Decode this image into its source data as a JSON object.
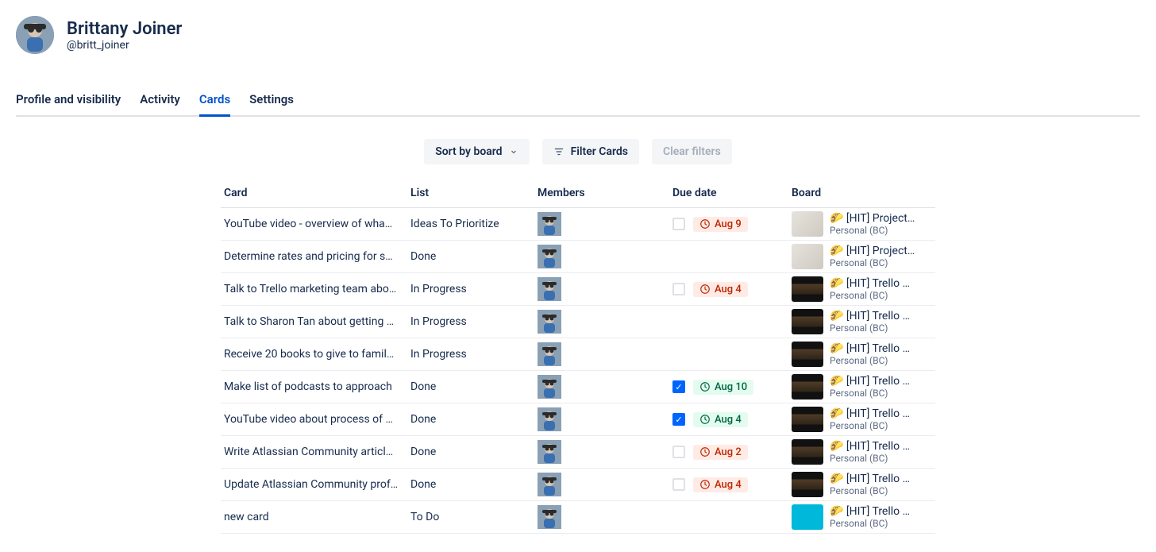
{
  "user": {
    "display_name": "Brittany Joiner",
    "handle": "@britt_joiner"
  },
  "tabs": [
    {
      "label": "Profile and visibility",
      "active": false
    },
    {
      "label": "Activity",
      "active": false
    },
    {
      "label": "Cards",
      "active": true
    },
    {
      "label": "Settings",
      "active": false
    }
  ],
  "controls": {
    "sort_label": "Sort by board",
    "filter_label": "Filter Cards",
    "clear_label": "Clear filters"
  },
  "columns": {
    "card": "Card",
    "list": "List",
    "members": "Members",
    "due": "Due date",
    "board": "Board"
  },
  "rows": [
    {
      "card": "YouTube video - overview of wha…",
      "list": "Ideas To Prioritize",
      "due": {
        "text": "Aug 9",
        "state": "overdue",
        "checked": false
      },
      "board": {
        "emoji": "🌮",
        "name": "[HIT] Project…",
        "sub": "Personal (BC)",
        "thumb": "light"
      }
    },
    {
      "card": "Determine rates and pricing for s…",
      "list": "Done",
      "due": null,
      "board": {
        "emoji": "🌮",
        "name": "[HIT] Project…",
        "sub": "Personal (BC)",
        "thumb": "light"
      }
    },
    {
      "card": "Talk to Trello marketing team abo…",
      "list": "In Progress",
      "due": {
        "text": "Aug 4",
        "state": "overdue",
        "checked": false
      },
      "board": {
        "emoji": "🌮",
        "name": "[HIT] Trello …",
        "sub": "Personal (BC)",
        "thumb": "dark"
      }
    },
    {
      "card": "Talk to Sharon Tan about getting …",
      "list": "In Progress",
      "due": null,
      "board": {
        "emoji": "🌮",
        "name": "[HIT] Trello …",
        "sub": "Personal (BC)",
        "thumb": "dark"
      }
    },
    {
      "card": "Receive 20 books to give to famil…",
      "list": "In Progress",
      "due": null,
      "board": {
        "emoji": "🌮",
        "name": "[HIT] Trello …",
        "sub": "Personal (BC)",
        "thumb": "dark"
      }
    },
    {
      "card": "Make list of podcasts to approach",
      "list": "Done",
      "due": {
        "text": "Aug 10",
        "state": "done",
        "checked": true
      },
      "board": {
        "emoji": "🌮",
        "name": "[HIT] Trello …",
        "sub": "Personal (BC)",
        "thumb": "dark"
      }
    },
    {
      "card": "YouTube video about process of …",
      "list": "Done",
      "due": {
        "text": "Aug 4",
        "state": "done",
        "checked": true
      },
      "board": {
        "emoji": "🌮",
        "name": "[HIT] Trello …",
        "sub": "Personal (BC)",
        "thumb": "dark"
      }
    },
    {
      "card": "Write Atlassian Community articl…",
      "list": "Done",
      "due": {
        "text": "Aug 2",
        "state": "overdue",
        "checked": false
      },
      "board": {
        "emoji": "🌮",
        "name": "[HIT] Trello …",
        "sub": "Personal (BC)",
        "thumb": "dark"
      }
    },
    {
      "card": "Update Atlassian Community prof…",
      "list": "Done",
      "due": {
        "text": "Aug 4",
        "state": "overdue",
        "checked": false
      },
      "board": {
        "emoji": "🌮",
        "name": "[HIT] Trello …",
        "sub": "Personal (BC)",
        "thumb": "dark"
      }
    },
    {
      "card": "new card",
      "list": "To Do",
      "due": null,
      "board": {
        "emoji": "🌮",
        "name": "[HIT] Trello …",
        "sub": "Personal (BC)",
        "thumb": "teal"
      }
    }
  ]
}
